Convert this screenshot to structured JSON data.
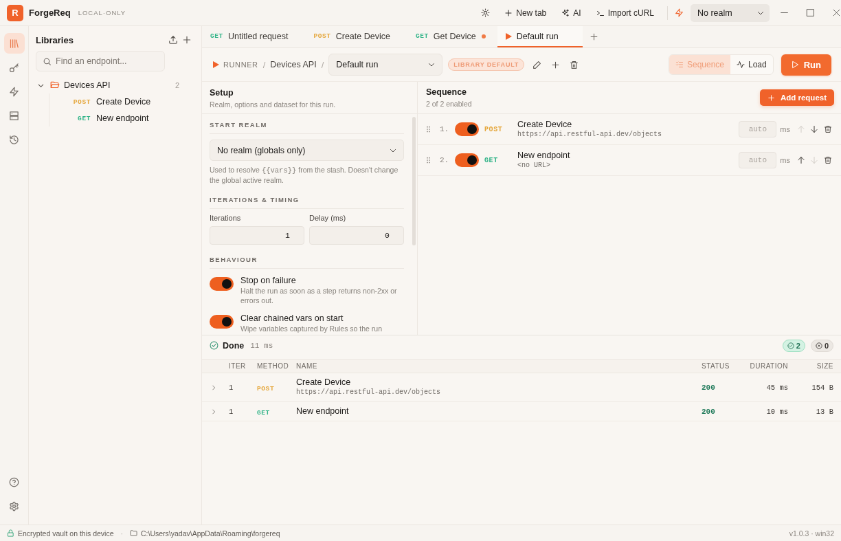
{
  "app": {
    "logo": "R",
    "name": "ForgeReq",
    "badge": "LOCAL·ONLY"
  },
  "title_bar": {
    "actions": [
      {
        "label": "New tab"
      },
      {
        "label": "AI"
      },
      {
        "label": "Import cURL"
      }
    ],
    "realm_select": {
      "value": "No realm"
    }
  },
  "rail": {
    "items": [
      {
        "selected": true
      },
      {
        "selected": false
      },
      {
        "selected": false
      },
      {
        "selected": false
      },
      {
        "selected": false
      }
    ]
  },
  "sidebar": {
    "title": "Libraries",
    "search": {
      "placeholder": "Find an endpoint..."
    },
    "tree": [
      {
        "name": "Devices API",
        "count": "2",
        "expanded": true,
        "children": [
          {
            "method": "POST",
            "color": "#e5a63a",
            "name": "Create Device"
          },
          {
            "method": "GET",
            "color": "#2fb387",
            "name": "New endpoint"
          }
        ]
      }
    ]
  },
  "tabs": [
    {
      "kind": "request",
      "method": "GET",
      "color": "#2fb387",
      "title": "Untitled request",
      "modified": false,
      "selected": false
    },
    {
      "kind": "request",
      "method": "POST",
      "color": "#e5a63a",
      "title": "Create Device",
      "modified": false,
      "selected": false
    },
    {
      "kind": "request",
      "method": "GET",
      "color": "#2fb387",
      "title": "Get Device",
      "modified": true,
      "selected": false
    },
    {
      "kind": "runner",
      "title": "Default run",
      "modified": false,
      "selected": true
    }
  ],
  "runner_bar": {
    "breadcrumb": [
      {
        "kind": "root",
        "text": "RUNNER"
      },
      {
        "kind": "separator",
        "text": "/"
      },
      {
        "kind": "crumb",
        "text": "Devices API"
      },
      {
        "kind": "separator",
        "text": "/"
      }
    ],
    "run_select": {
      "value": "Default run"
    },
    "badge": "LIBRARY DEFAULT",
    "view_modes": [
      {
        "label": "Sequence",
        "selected": true
      },
      {
        "label": "Load",
        "selected": false
      }
    ],
    "run_button": "Run"
  },
  "setup": {
    "title": "Setup",
    "subtitle": "Realm, options and dataset for this run.",
    "start_realm": {
      "heading": "START REALM",
      "value": "No realm (globals only)",
      "help": {
        "before": "Used to resolve ",
        "code": "{{vars}}",
        "after": " from the stash. Doesn't change the global active realm."
      }
    },
    "timing": {
      "heading": "ITERATIONS & TIMING",
      "fields": [
        {
          "label": "Iterations",
          "value": "1"
        },
        {
          "label": "Delay (ms)",
          "value": "0"
        }
      ]
    },
    "behaviour": {
      "heading": "BEHAVIOUR",
      "options": [
        {
          "label": "Stop on failure",
          "description": "Halt the run as soon as a step returns non-2xx or errors out.",
          "on": true
        },
        {
          "label": "Clear chained vars on start",
          "description": "Wipe variables captured by Rules so the run",
          "on": true
        }
      ]
    }
  },
  "sequence": {
    "title": "Sequence",
    "summary": "2 of 2 enabled",
    "add_button": "Add request",
    "steps": [
      {
        "number": "1.",
        "enabled": true,
        "method": "POST",
        "color": "#e5a63a",
        "name": "Create Device",
        "url": "https://api.restful-api.dev/objects",
        "delay_placeholder": "auto",
        "unit": "ms",
        "can_move_up": false,
        "can_move_down": true
      },
      {
        "number": "2.",
        "enabled": true,
        "method": "GET",
        "color": "#2fb387",
        "name": "New endpoint",
        "url": "<no URL>",
        "delay_placeholder": "auto",
        "unit": "ms",
        "can_move_up": true,
        "can_move_down": false
      }
    ]
  },
  "results": {
    "status": "Done",
    "elapsed": "11 ms",
    "passed": "2",
    "failed": "0",
    "columns": [
      "ITER",
      "METHOD",
      "NAME",
      "STATUS",
      "DURATION",
      "SIZE"
    ],
    "rows": [
      {
        "expanded": false,
        "iter": "1",
        "method": "POST",
        "color": "#e5a63a",
        "name": "Create Device",
        "url": "https://api.restful-api.dev/objects",
        "status": "200",
        "duration": "45 ms",
        "size": "154 B"
      },
      {
        "expanded": false,
        "iter": "1",
        "method": "GET",
        "color": "#2fb387",
        "name": "New endpoint",
        "status": "200",
        "duration": "10 ms",
        "size": "13 B"
      }
    ]
  },
  "status_bar": {
    "vault": "Encrypted vault on this device",
    "separator": "·",
    "path": "C:\\Users\\yadav\\AppData\\Roaming\\forgereq",
    "version": "v1.0.3 · win32"
  }
}
